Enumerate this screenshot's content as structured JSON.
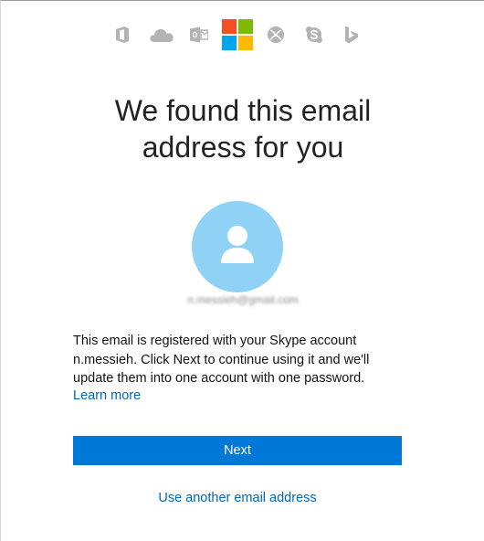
{
  "service_icons": [
    {
      "name": "office-icon"
    },
    {
      "name": "onedrive-icon"
    },
    {
      "name": "outlook-icon"
    },
    {
      "name": "microsoft-logo-icon"
    },
    {
      "name": "xbox-icon"
    },
    {
      "name": "skype-icon"
    },
    {
      "name": "bing-icon"
    }
  ],
  "colors": {
    "icon_gray": "#b3b3b3",
    "ms_red": "#f25022",
    "ms_green": "#7fba00",
    "ms_blue": "#00a4ef",
    "ms_yellow": "#ffb900",
    "avatar_bg": "#8fd2f5",
    "button_bg": "#0078d7",
    "link": "#0067b8"
  },
  "heading": {
    "line1": "We found this email",
    "line2": "address for you"
  },
  "account": {
    "avatar_icon": "person-icon",
    "email": "n.messieh@gmail.com"
  },
  "description": "This email is registered with your Skype account n.messieh. Click Next to continue using it and we'll update them into one account with one password.",
  "learn_more_label": "Learn more",
  "next_button_label": "Next",
  "alt_link_label": "Use another email address"
}
